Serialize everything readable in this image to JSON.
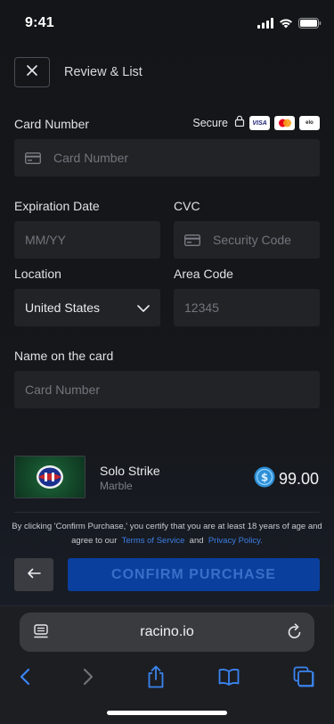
{
  "status_bar": {
    "time": "9:41"
  },
  "header": {
    "title": "Review & List"
  },
  "form": {
    "card_number_label": "Card Number",
    "secure_text": "Secure",
    "card_number_placeholder": "Card Number",
    "expiration_label": "Expiration Date",
    "expiration_placeholder": "MM/YY",
    "cvc_label": "CVC",
    "cvc_placeholder": "Security Code",
    "location_label": "Location",
    "location_value": "United States",
    "area_code_label": "Area Code",
    "area_code_placeholder": "12345",
    "name_label": "Name on the card",
    "name_placeholder": "Card Number"
  },
  "card_brands": [
    "visa",
    "mastercard",
    "elo"
  ],
  "product": {
    "name": "Solo Strike",
    "subtitle": "Marble",
    "price": "99.00"
  },
  "terms": {
    "text_part1": "By clicking 'Confirm Purchase,' you certify that you are at least 18 years of age and agree to our",
    "link1": "Terms of Service",
    "and": "and",
    "link2": "Privacy Policy."
  },
  "actions": {
    "confirm_label": "CONFIRM PURCHASE"
  },
  "browser": {
    "url": "racino.io"
  },
  "colors": {
    "background": "#141518",
    "field": "#222327",
    "accent_blue": "#0a3f9e",
    "link": "#3d7fe6",
    "coin": "#2e8fd6"
  }
}
